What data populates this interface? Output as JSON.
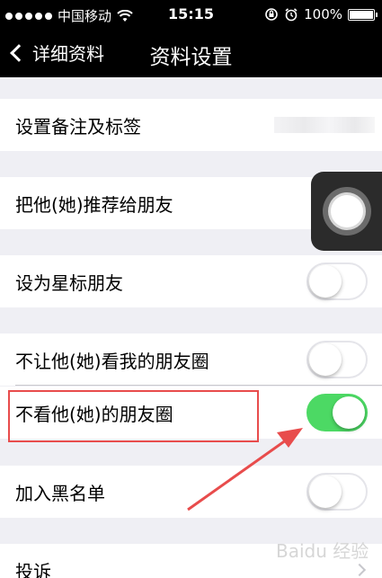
{
  "status_bar": {
    "carrier": "中国移动",
    "time": "15:15",
    "battery_percent": "100%",
    "battery_level": 1.0,
    "signal_dots": 5
  },
  "nav": {
    "back_label": "详细资料",
    "title": "资料设置"
  },
  "rows": {
    "remark": {
      "label": "设置备注及标签"
    },
    "recommend": {
      "label": "把他(她)推荐给朋友"
    },
    "star": {
      "label": "设为星标朋友",
      "toggle_on": false
    },
    "hide_my_moments": {
      "label": "不让他(她)看我的朋友圈",
      "toggle_on": false
    },
    "hide_their_moments": {
      "label": "不看他(她)的朋友圈",
      "toggle_on": true
    },
    "blacklist": {
      "label": "加入黑名单",
      "toggle_on": false
    },
    "report": {
      "label": "投诉"
    }
  },
  "colors": {
    "toggle_on": "#4cd964",
    "annotation_red": "#e84c4c",
    "background": "#efeff4"
  },
  "icons": [
    "wifi-icon",
    "lock-rotation-icon",
    "alarm-icon",
    "battery-icon",
    "chevron-left-icon",
    "chevron-right-icon",
    "assistive-touch-icon"
  ],
  "watermark": "Baidu 经验"
}
